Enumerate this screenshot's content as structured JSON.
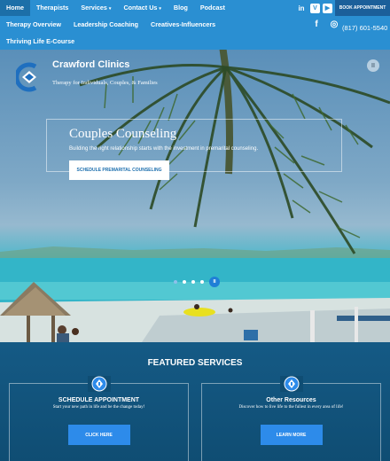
{
  "nav": {
    "items": [
      {
        "label": "Home",
        "active": true
      },
      {
        "label": "Therapists"
      },
      {
        "label": "Services",
        "caret": "▾"
      },
      {
        "label": "Contact Us",
        "caret": "▾"
      },
      {
        "label": "Blog"
      },
      {
        "label": "Podcast"
      }
    ],
    "row2": [
      "Therapy Overview",
      "Leadership Coaching",
      "Creatives-Influencers"
    ],
    "row3": [
      "Thriving Life E-Course"
    ],
    "social_top": [
      {
        "icon": "linkedin-icon",
        "glyph": "in"
      },
      {
        "icon": "vimeo-icon",
        "glyph": "V"
      },
      {
        "icon": "youtube-icon",
        "glyph": "▶"
      }
    ],
    "social_row2": [
      {
        "icon": "facebook-icon",
        "glyph": "f"
      },
      {
        "icon": "instagram-icon",
        "glyph": "◎"
      }
    ],
    "book_label": "BOOK APPOINTMENT",
    "phone": "(817) 601-5540"
  },
  "hero": {
    "brand_name": "Crawford Clinics",
    "brand_tag": "Therapy for Individuals, Couples, & Families",
    "slide_title": "Couples Counseling",
    "slide_sub": "Building the right relationship starts with the investment in premarital counseling.",
    "slide_button": "SCHEDULE PREMARITAL COUNSELING",
    "pause_glyph": "II",
    "slide_count": 4,
    "active_slide": 1
  },
  "featured": {
    "heading": "FEATURED SERVICES",
    "cards": [
      {
        "title": "SCHEDULE APPOINTMENT",
        "text": "Start your new path in life and be the change today!",
        "button": "CLICK HERE"
      },
      {
        "title": "Other Resources",
        "text": "Discover how to live life to the fullest in every area of life!",
        "button": "LEARN MORE"
      }
    ]
  },
  "colors": {
    "nav": "#2a8fd2",
    "accent": "#2d8bea",
    "footer": "#0f4d73"
  }
}
